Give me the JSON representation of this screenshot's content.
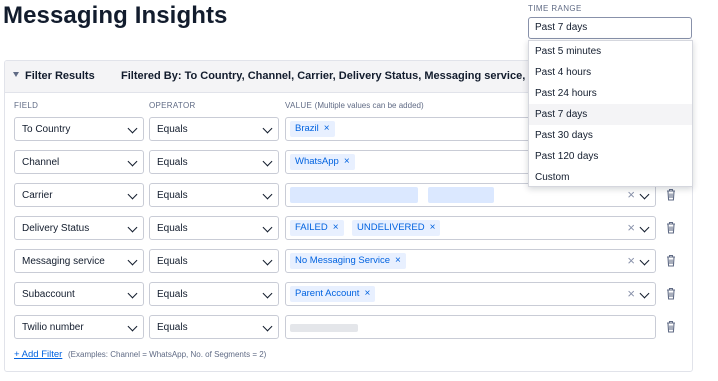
{
  "page": {
    "title": "Messaging Insights"
  },
  "time_range": {
    "label": "TIME RANGE",
    "selected": "Past 7 days",
    "options": [
      "Past 5 minutes",
      "Past 4 hours",
      "Past 24 hours",
      "Past 7 days",
      "Past 30 days",
      "Past 120 days",
      "Custom"
    ],
    "selected_index": 3
  },
  "filter_panel": {
    "title": "Filter Results",
    "filtered_by": "Filtered By: To Country, Channel, Carrier, Delivery Status, Messaging service, Su",
    "columns": {
      "field": "FIELD",
      "operator": "OPERATOR",
      "value": "VALUE",
      "value_hint": "(Multiple values can be added)"
    },
    "rows": [
      {
        "field": "To Country",
        "operator": "Equals",
        "chips": [
          "Brazil"
        ]
      },
      {
        "field": "Channel",
        "operator": "Equals",
        "chips": [
          "WhatsApp"
        ]
      },
      {
        "field": "Carrier",
        "operator": "Equals",
        "chips": []
      },
      {
        "field": "Delivery Status",
        "operator": "Equals",
        "chips": [
          "FAILED",
          "UNDELIVERED"
        ]
      },
      {
        "field": "Messaging service",
        "operator": "Equals",
        "chips": [
          "No Messaging Service"
        ]
      },
      {
        "field": "Subaccount",
        "operator": "Equals",
        "chips": [
          "Parent Account"
        ]
      },
      {
        "field": "Twilio number",
        "operator": "Equals",
        "chips": []
      }
    ],
    "add_filter": "+ Add Filter",
    "add_filter_hint": "(Examples: Channel = WhatsApp, No. of Segments = 2)"
  },
  "icons": {
    "remove_chip": "×",
    "clear_all": "×",
    "trash": "trash-icon",
    "chevron": "chevron-down-icon",
    "collapse": "caret-down-icon"
  },
  "colors": {
    "link": "#0263e0",
    "chip_bg": "#e8f0ff",
    "text": "#121c2d",
    "muted": "#606b85"
  }
}
